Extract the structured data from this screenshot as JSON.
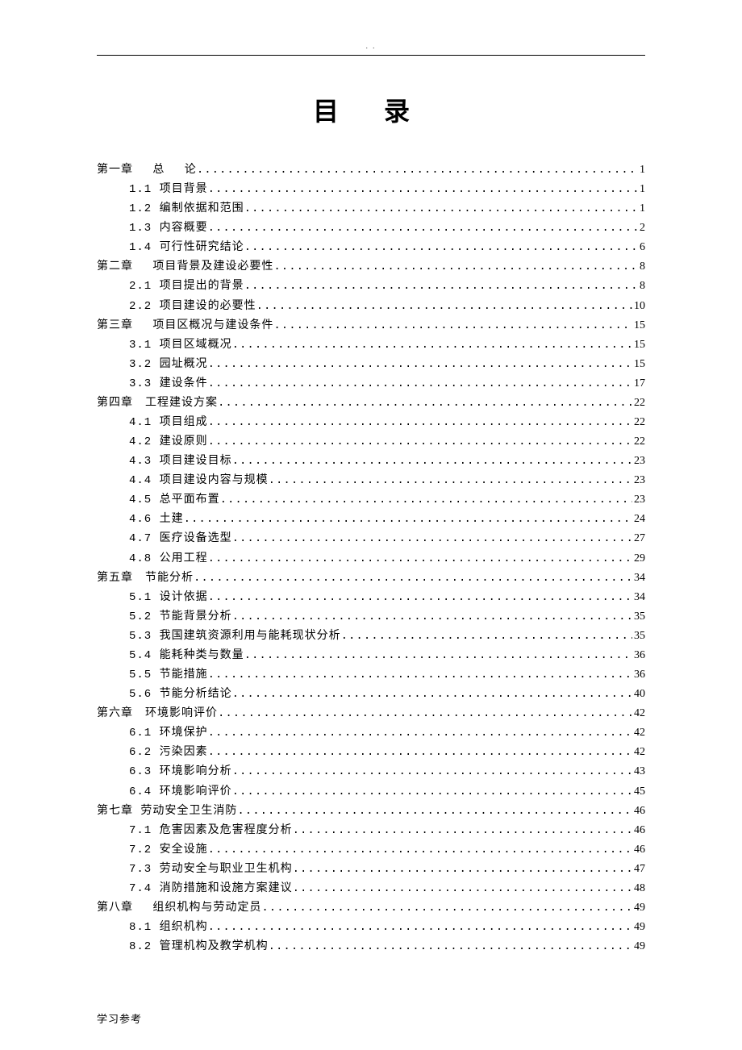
{
  "header_marker": ". .",
  "title": "目 录",
  "footer": "学习参考",
  "toc": [
    {
      "level": 0,
      "label": "第一章　 总　 论",
      "page": "1"
    },
    {
      "level": 1,
      "label": "1.1 项目背景",
      "page": "1"
    },
    {
      "level": 1,
      "label": "1.2 编制依据和范围",
      "page": "1"
    },
    {
      "level": 1,
      "label": "1.3 内容概要",
      "page": "2"
    },
    {
      "level": 1,
      "label": "1.4 可行性研究结论",
      "page": "6"
    },
    {
      "level": 0,
      "label": "第二章　 项目背景及建设必要性 ",
      "page": "8"
    },
    {
      "level": 1,
      "label": "2.1 项目提出的背景",
      "page": "8"
    },
    {
      "level": 1,
      "label": "2.2 项目建设的必要性",
      "page": "10"
    },
    {
      "level": 0,
      "label": "第三章　 项目区概况与建设条件 ",
      "page": "15"
    },
    {
      "level": 1,
      "label": "3.1 项目区域概况",
      "page": "15"
    },
    {
      "level": 1,
      "label": "3.2 园址概况",
      "page": "15"
    },
    {
      "level": 1,
      "label": "3.3 建设条件",
      "page": "17"
    },
    {
      "level": 0,
      "label": "第四章　工程建设方案 ",
      "page": "22"
    },
    {
      "level": 1,
      "label": "4.1 项目组成",
      "page": "22"
    },
    {
      "level": 1,
      "label": "4.2 建设原则",
      "page": "22"
    },
    {
      "level": 1,
      "label": "4.3 项目建设目标",
      "page": "23"
    },
    {
      "level": 1,
      "label": "4.4 项目建设内容与规模",
      "page": "23"
    },
    {
      "level": 1,
      "label": "4.5 总平面布置",
      "page": "23"
    },
    {
      "level": 1,
      "label": "4.6 土建",
      "page": "24"
    },
    {
      "level": 1,
      "label": "4.7 医疗设备选型",
      "page": "27"
    },
    {
      "level": 1,
      "label": "4.8 公用工程",
      "page": "29"
    },
    {
      "level": 0,
      "label": "第五章　节能分析 ",
      "page": "34"
    },
    {
      "level": 1,
      "label": "5.1 设计依据 ",
      "page": "34"
    },
    {
      "level": 1,
      "label": "5.2 节能背景分析",
      "page": "35"
    },
    {
      "level": 1,
      "label": "5.3 我国建筑资源利用与能耗现状分析",
      "page": "35"
    },
    {
      "level": 1,
      "label": "5.4 能耗种类与数量 ",
      "page": "36"
    },
    {
      "level": 1,
      "label": "5.5 节能措施",
      "page": "36"
    },
    {
      "level": 1,
      "label": "5.6 节能分析结论",
      "page": "40"
    },
    {
      "level": 0,
      "label": "第六章　环境影响评价 ",
      "page": "42"
    },
    {
      "level": 1,
      "label": "6.1 环境保护",
      "page": "42"
    },
    {
      "level": 1,
      "label": "6.2 污染因素",
      "page": "42"
    },
    {
      "level": 1,
      "label": "6.3 环境影响分析",
      "page": "43"
    },
    {
      "level": 1,
      "label": "6.4 环境影响评价",
      "page": "45"
    },
    {
      "level": 0,
      "label": "第七章 劳动安全卫生消防 ",
      "page": "46"
    },
    {
      "level": 1,
      "label": "7.1 危害因素及危害程度分析",
      "page": "46"
    },
    {
      "level": 1,
      "label": "7.2 安全设施",
      "page": "46"
    },
    {
      "level": 1,
      "label": "7.3 劳动安全与职业卫生机构",
      "page": "47"
    },
    {
      "level": 1,
      "label": "7.4 消防措施和设施方案建议",
      "page": "48"
    },
    {
      "level": 0,
      "label": "第八章　 组织机构与劳动定员 ",
      "page": "49"
    },
    {
      "level": 1,
      "label": "8.1 组织机构",
      "page": "49"
    },
    {
      "level": 1,
      "label": "8.2 管理机构及教学机构",
      "page": "49"
    }
  ]
}
